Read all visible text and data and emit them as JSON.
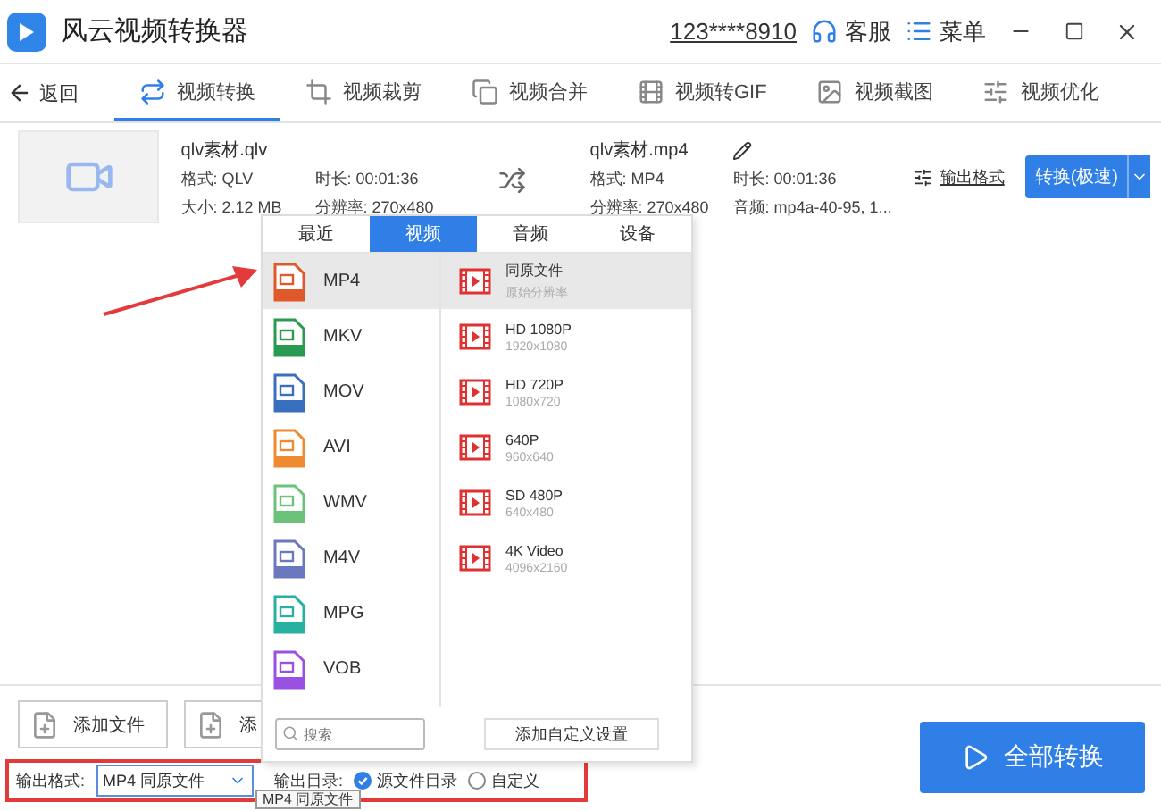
{
  "window": {
    "title": "风云视频转换器",
    "account": "123****8910",
    "support": "客服",
    "menu": "菜单"
  },
  "nav": {
    "back": "返回",
    "tabs": [
      {
        "label": "视频转换",
        "selected": true
      },
      {
        "label": "视频裁剪",
        "selected": false
      },
      {
        "label": "视频合并",
        "selected": false
      },
      {
        "label": "视频转GIF",
        "selected": false
      },
      {
        "label": "视频截图",
        "selected": false
      },
      {
        "label": "视频优化",
        "selected": false
      }
    ]
  },
  "file": {
    "source": {
      "name": "qlv素材.qlv",
      "format": "格式: QLV",
      "size": "大小: 2.12 MB",
      "duration": "时长: 00:01:36",
      "resolution": "分辨率: 270x480"
    },
    "output": {
      "name": "qlv素材.mp4",
      "format": "格式: MP4",
      "resolution": "分辨率: 270x480",
      "duration": "时长: 00:01:36",
      "audio": "音频: mp4a-40-95, 1..."
    },
    "output_format_link": "输出格式",
    "convert_button": "转换(极速)"
  },
  "format_popup": {
    "tabs": [
      {
        "label": "最近",
        "selected": false
      },
      {
        "label": "视频",
        "selected": true
      },
      {
        "label": "音频",
        "selected": false
      },
      {
        "label": "设备",
        "selected": false
      }
    ],
    "formats": [
      {
        "label": "MP4",
        "selected": true,
        "color": "#e0592a"
      },
      {
        "label": "MKV",
        "selected": false,
        "color": "#2a9a52"
      },
      {
        "label": "MOV",
        "selected": false,
        "color": "#3a6fc0"
      },
      {
        "label": "AVI",
        "selected": false,
        "color": "#f08a30"
      },
      {
        "label": "WMV",
        "selected": false,
        "color": "#6cc27a"
      },
      {
        "label": "M4V",
        "selected": false,
        "color": "#6a78c0"
      },
      {
        "label": "MPG",
        "selected": false,
        "color": "#28b0a0"
      },
      {
        "label": "VOB",
        "selected": false,
        "color": "#9a50e0"
      }
    ],
    "presets": [
      {
        "title": "同原文件",
        "subtitle": "原始分辨率",
        "selected": true
      },
      {
        "title": "HD 1080P",
        "subtitle": "1920x1080",
        "selected": false
      },
      {
        "title": "HD 720P",
        "subtitle": "1080x720",
        "selected": false
      },
      {
        "title": "640P",
        "subtitle": "960x640",
        "selected": false
      },
      {
        "title": "SD 480P",
        "subtitle": "640x480",
        "selected": false
      },
      {
        "title": "4K Video",
        "subtitle": "4096x2160",
        "selected": false
      }
    ],
    "search_placeholder": "搜索",
    "add_custom": "添加自定义设置"
  },
  "bottom": {
    "buttons": [
      "添加文件",
      "添"
    ],
    "output_format_label": "输出格式:",
    "output_format_value": "MP4 同原文件",
    "output_dir_label": "输出目录:",
    "dir_options": [
      {
        "label": "源文件目录",
        "selected": true
      },
      {
        "label": "自定义",
        "selected": false
      }
    ],
    "convert_all": "全部转换",
    "tooltip": "MP4 同原文件"
  }
}
